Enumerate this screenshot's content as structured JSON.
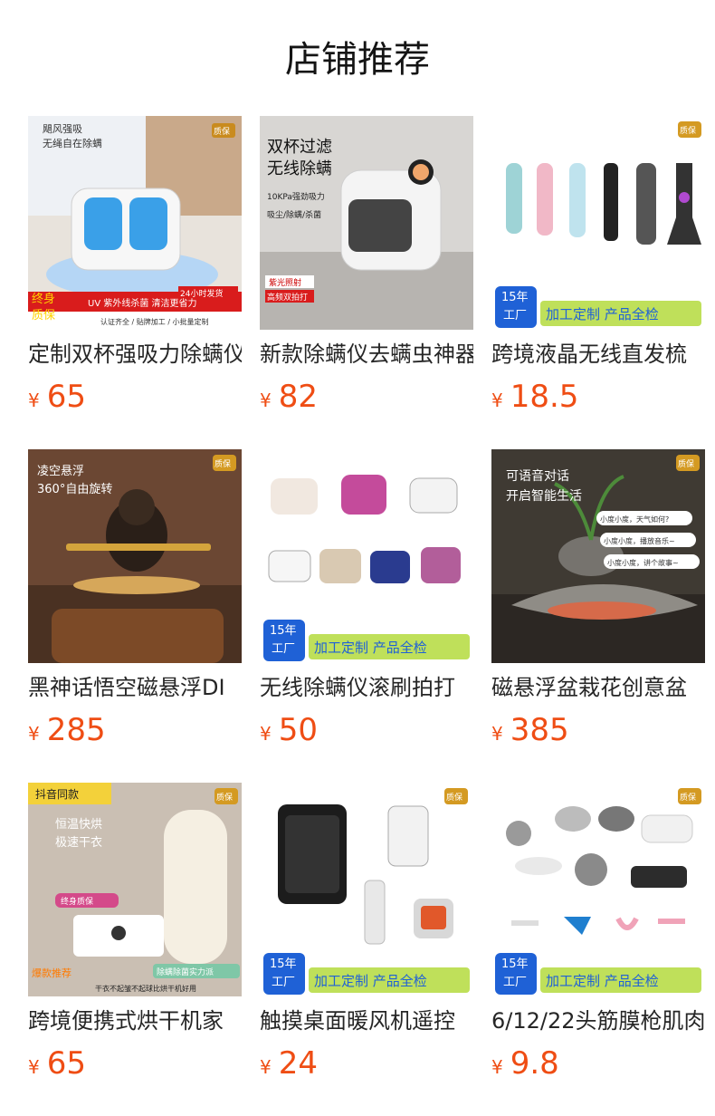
{
  "header": {
    "title": "店铺推荐"
  },
  "badge": {
    "warranty": "质保",
    "years": "15年",
    "factory": "工厂",
    "custom_label": "加工定制 产品全检"
  },
  "products": [
    {
      "name": "定制双杯强吸力除螨仪",
      "currency": "¥",
      "price": "65",
      "image_text": [
        "飓风强吸",
        "无绳自在除螨",
        "24小时发货",
        "终身",
        "质保",
        "UV 紫外线杀菌 清洁更省力",
        "认证齐全 / 贴牌加工 / 小批量定制"
      ]
    },
    {
      "name": "新款除螨仪去螨虫神器",
      "currency": "¥",
      "price": "82",
      "image_text": [
        "双杯过滤",
        "无线除螨",
        "10KPa强劲吸力",
        "吸尘/除螨/杀菌",
        "紫光照射",
        "高频双拍打"
      ]
    },
    {
      "name": "跨境液晶无线直发梳",
      "currency": "¥",
      "price": "18.5",
      "image_text": []
    },
    {
      "name": "黑神话悟空磁悬浮DI",
      "currency": "¥",
      "price": "285",
      "image_text": [
        "凌空悬浮",
        "360°自由旋转"
      ]
    },
    {
      "name": "无线除螨仪滚刷拍打",
      "currency": "¥",
      "price": "50",
      "image_text": []
    },
    {
      "name": "磁悬浮盆栽花创意盆",
      "currency": "¥",
      "price": "385",
      "image_text": [
        "可语音对话",
        "开启智能生活",
        "小度小度，天气如何?",
        "小度小度，播放音乐~",
        "小度小度，讲个故事~"
      ]
    },
    {
      "name": "跨境便携式烘干机家",
      "currency": "¥",
      "price": "65",
      "image_text": [
        "抖音同款",
        "恒温快烘",
        "极速干衣",
        "终身质保",
        "除螨除菌实力派",
        "爆款推荐",
        "干衣不起皱不起球比烘干机好用"
      ]
    },
    {
      "name": "触摸桌面暖风机遥控",
      "currency": "¥",
      "price": "24",
      "image_text": []
    },
    {
      "name": "6/12/22头筋膜枪肌肉",
      "currency": "¥",
      "price": "9.8",
      "image_text": []
    }
  ]
}
